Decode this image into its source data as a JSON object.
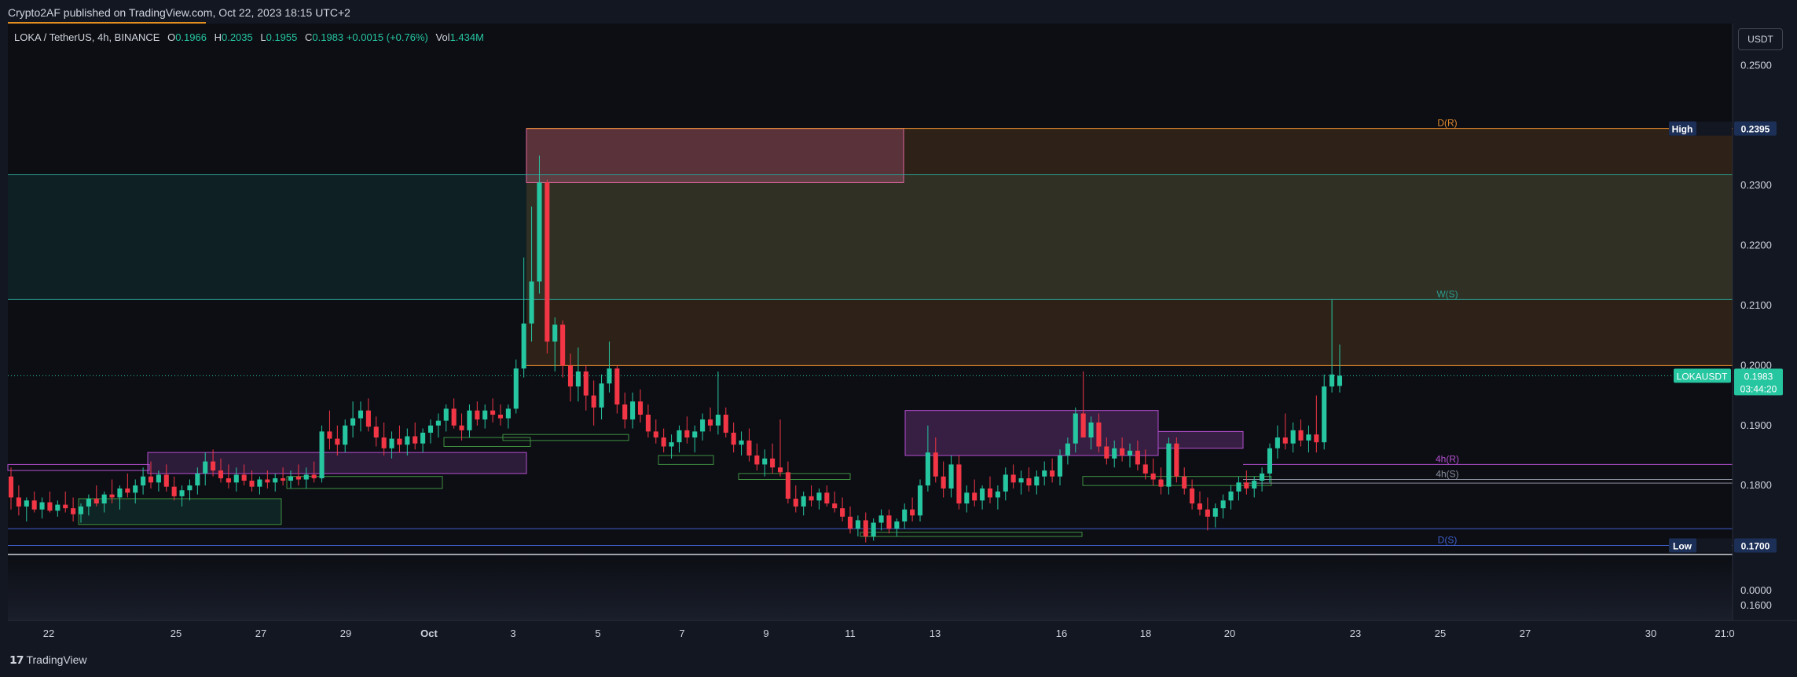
{
  "publisher": "Crypto2AF published on TradingView.com, Oct 22, 2023 18:15 UTC+2",
  "legend": {
    "symbol": "LOKA / TetherUS, 4h, BINANCE",
    "open_label": "O",
    "open": "0.1966",
    "high_label": "H",
    "high": "0.2035",
    "low_label": "L",
    "low": "0.1955",
    "close_label": "C",
    "close": "0.1983",
    "change": "+0.0015 (+0.76%)",
    "vol_label": "Vol",
    "vol": "1.434M"
  },
  "currency_button": "USDT",
  "footer_logo": "TradingView",
  "colors": {
    "background": "#0c0e14",
    "up": "#26c6a0",
    "down": "#f23645",
    "daily": "#e0892d",
    "weekly": "#2a9d8f",
    "h4": "#b64fd1",
    "daily_support": "#3f5ec7"
  },
  "chart_data": {
    "type": "candlestick",
    "symbol": "LOKAUSDT",
    "timeframe": "4h",
    "ylim": [
      0.1575,
      0.257
    ],
    "y_ticks": [
      "0.2500",
      "0.2300",
      "0.2200",
      "0.2100",
      "0.2000",
      "0.1900",
      "0.1800",
      "0.1600",
      "0.0000"
    ],
    "x_ticks": [
      "22",
      "25",
      "27",
      "29",
      "Oct",
      "3",
      "5",
      "7",
      "9",
      "11",
      "13",
      "16",
      "18",
      "20",
      "23",
      "25",
      "27",
      "30",
      "21:0"
    ],
    "levels": [
      {
        "label": "D(R)",
        "value": 0.2395
      },
      {
        "label": "W(S)",
        "value": 0.211
      },
      {
        "label": "4h(R)",
        "value": 0.1835
      },
      {
        "label": "4h(S)",
        "value": 0.181
      },
      {
        "label": "D(S)",
        "value": 0.17
      }
    ],
    "high": {
      "label": "High",
      "value": "0.2395"
    },
    "low": {
      "label": "Low",
      "value": "0.1700"
    },
    "last_price": {
      "symbol": "LOKAUSDT",
      "value": "0.1983",
      "countdown": "03:44:20"
    },
    "candles": [
      [
        0.1815,
        0.183,
        0.176,
        0.178
      ],
      [
        0.178,
        0.18,
        0.175,
        0.1765
      ],
      [
        0.1765,
        0.178,
        0.174,
        0.1775
      ],
      [
        0.1775,
        0.179,
        0.1755,
        0.176
      ],
      [
        0.176,
        0.178,
        0.1745,
        0.1772
      ],
      [
        0.1772,
        0.179,
        0.1755,
        0.1758
      ],
      [
        0.1758,
        0.1775,
        0.1748,
        0.1768
      ],
      [
        0.1768,
        0.179,
        0.1755,
        0.1762
      ],
      [
        0.1762,
        0.178,
        0.174,
        0.1752
      ],
      [
        0.1752,
        0.177,
        0.1738,
        0.1765
      ],
      [
        0.1765,
        0.1785,
        0.175,
        0.1778
      ],
      [
        0.1778,
        0.18,
        0.1765,
        0.177
      ],
      [
        0.177,
        0.179,
        0.1755,
        0.1785
      ],
      [
        0.1785,
        0.181,
        0.177,
        0.178
      ],
      [
        0.178,
        0.18,
        0.176,
        0.1795
      ],
      [
        0.1795,
        0.182,
        0.178,
        0.1788
      ],
      [
        0.1788,
        0.181,
        0.177,
        0.18
      ],
      [
        0.18,
        0.183,
        0.1785,
        0.1815
      ],
      [
        0.1815,
        0.184,
        0.1795,
        0.1805
      ],
      [
        0.1805,
        0.1825,
        0.179,
        0.1818
      ],
      [
        0.1818,
        0.1835,
        0.179,
        0.1798
      ],
      [
        0.1798,
        0.1815,
        0.1775,
        0.1782
      ],
      [
        0.1782,
        0.18,
        0.1765,
        0.1792
      ],
      [
        0.1792,
        0.181,
        0.1775,
        0.18
      ],
      [
        0.18,
        0.183,
        0.1785,
        0.182
      ],
      [
        0.182,
        0.1855,
        0.18,
        0.184
      ],
      [
        0.184,
        0.186,
        0.1815,
        0.1825
      ],
      [
        0.1825,
        0.1845,
        0.1805,
        0.1812
      ],
      [
        0.1812,
        0.1835,
        0.1795,
        0.1805
      ],
      [
        0.1805,
        0.183,
        0.179,
        0.1818
      ],
      [
        0.1818,
        0.1835,
        0.18,
        0.1808
      ],
      [
        0.1808,
        0.1825,
        0.179,
        0.1798
      ],
      [
        0.1798,
        0.1815,
        0.1785,
        0.181
      ],
      [
        0.181,
        0.1825,
        0.1795,
        0.1805
      ],
      [
        0.1805,
        0.182,
        0.179,
        0.1812
      ],
      [
        0.1812,
        0.183,
        0.18,
        0.1808
      ],
      [
        0.1808,
        0.1825,
        0.1795,
        0.1815
      ],
      [
        0.1815,
        0.1835,
        0.18,
        0.181
      ],
      [
        0.181,
        0.183,
        0.1795,
        0.1818
      ],
      [
        0.1818,
        0.184,
        0.1805,
        0.1812
      ],
      [
        0.1812,
        0.19,
        0.1805,
        0.189
      ],
      [
        0.189,
        0.1925,
        0.186,
        0.1878
      ],
      [
        0.1878,
        0.19,
        0.185,
        0.1868
      ],
      [
        0.1868,
        0.191,
        0.1855,
        0.19
      ],
      [
        0.19,
        0.194,
        0.188,
        0.1912
      ],
      [
        0.1912,
        0.194,
        0.189,
        0.1925
      ],
      [
        0.1925,
        0.1945,
        0.189,
        0.1898
      ],
      [
        0.1898,
        0.1915,
        0.1865,
        0.188
      ],
      [
        0.188,
        0.1905,
        0.185,
        0.1862
      ],
      [
        0.1862,
        0.189,
        0.1845,
        0.1878
      ],
      [
        0.1878,
        0.19,
        0.1855,
        0.1868
      ],
      [
        0.1868,
        0.1895,
        0.185,
        0.1882
      ],
      [
        0.1882,
        0.1905,
        0.186,
        0.187
      ],
      [
        0.187,
        0.1895,
        0.1855,
        0.1888
      ],
      [
        0.1888,
        0.191,
        0.187,
        0.19
      ],
      [
        0.19,
        0.192,
        0.188,
        0.1908
      ],
      [
        0.1908,
        0.1935,
        0.189,
        0.1928
      ],
      [
        0.1928,
        0.1945,
        0.1895,
        0.19
      ],
      [
        0.19,
        0.192,
        0.1875,
        0.1892
      ],
      [
        0.1892,
        0.1935,
        0.188,
        0.1925
      ],
      [
        0.1925,
        0.194,
        0.19,
        0.191
      ],
      [
        0.191,
        0.1935,
        0.1895,
        0.1925
      ],
      [
        0.1925,
        0.1945,
        0.1905,
        0.1918
      ],
      [
        0.1918,
        0.1935,
        0.19,
        0.1912
      ],
      [
        0.1912,
        0.1935,
        0.1895,
        0.1928
      ],
      [
        0.1928,
        0.201,
        0.192,
        0.1995
      ],
      [
        0.1995,
        0.218,
        0.198,
        0.207
      ],
      [
        0.207,
        0.2265,
        0.204,
        0.214
      ],
      [
        0.214,
        0.235,
        0.212,
        0.2305
      ],
      [
        0.2305,
        0.231,
        0.202,
        0.204
      ],
      [
        0.204,
        0.208,
        0.199,
        0.2068
      ],
      [
        0.2068,
        0.2075,
        0.198,
        0.2
      ],
      [
        0.2,
        0.202,
        0.194,
        0.1965
      ],
      [
        0.1965,
        0.203,
        0.194,
        0.199
      ],
      [
        0.199,
        0.2,
        0.1925,
        0.195
      ],
      [
        0.195,
        0.1975,
        0.19,
        0.193
      ],
      [
        0.193,
        0.1985,
        0.191,
        0.197
      ],
      [
        0.197,
        0.204,
        0.1955,
        0.1995
      ],
      [
        0.1995,
        0.2,
        0.192,
        0.1935
      ],
      [
        0.1935,
        0.1955,
        0.1895,
        0.191
      ],
      [
        0.191,
        0.1955,
        0.1895,
        0.194
      ],
      [
        0.194,
        0.196,
        0.1905,
        0.1918
      ],
      [
        0.1918,
        0.1935,
        0.188,
        0.189
      ],
      [
        0.189,
        0.191,
        0.187,
        0.188
      ],
      [
        0.188,
        0.1895,
        0.1855,
        0.1865
      ],
      [
        0.1865,
        0.1885,
        0.1845,
        0.1872
      ],
      [
        0.1872,
        0.19,
        0.1855,
        0.1892
      ],
      [
        0.1892,
        0.1915,
        0.187,
        0.188
      ],
      [
        0.188,
        0.19,
        0.1855,
        0.189
      ],
      [
        0.189,
        0.192,
        0.1875,
        0.191
      ],
      [
        0.191,
        0.193,
        0.189,
        0.19
      ],
      [
        0.19,
        0.199,
        0.1885,
        0.1918
      ],
      [
        0.1918,
        0.193,
        0.188,
        0.1888
      ],
      [
        0.1888,
        0.1905,
        0.1855,
        0.1868
      ],
      [
        0.1868,
        0.189,
        0.185,
        0.1875
      ],
      [
        0.1875,
        0.1895,
        0.184,
        0.185
      ],
      [
        0.185,
        0.187,
        0.1825,
        0.1835
      ],
      [
        0.1835,
        0.186,
        0.1815,
        0.1845
      ],
      [
        0.1845,
        0.187,
        0.182,
        0.183
      ],
      [
        0.183,
        0.191,
        0.1815,
        0.1822
      ],
      [
        0.1822,
        0.184,
        0.177,
        0.1778
      ],
      [
        0.1778,
        0.18,
        0.1755,
        0.1765
      ],
      [
        0.1765,
        0.179,
        0.175,
        0.1782
      ],
      [
        0.1782,
        0.18,
        0.1765,
        0.1775
      ],
      [
        0.1775,
        0.1795,
        0.176,
        0.1788
      ],
      [
        0.1788,
        0.18,
        0.1765,
        0.177
      ],
      [
        0.177,
        0.179,
        0.1755,
        0.1762
      ],
      [
        0.1762,
        0.178,
        0.174,
        0.1748
      ],
      [
        0.1748,
        0.1765,
        0.172,
        0.1728
      ],
      [
        0.1728,
        0.175,
        0.1715,
        0.1742
      ],
      [
        0.1742,
        0.1755,
        0.1705,
        0.1715
      ],
      [
        0.1715,
        0.1745,
        0.1708,
        0.1738
      ],
      [
        0.1738,
        0.176,
        0.1725,
        0.175
      ],
      [
        0.175,
        0.176,
        0.172,
        0.1728
      ],
      [
        0.1728,
        0.1745,
        0.1715,
        0.174
      ],
      [
        0.174,
        0.177,
        0.1728,
        0.176
      ],
      [
        0.176,
        0.178,
        0.174,
        0.175
      ],
      [
        0.175,
        0.181,
        0.174,
        0.18
      ],
      [
        0.18,
        0.19,
        0.179,
        0.1855
      ],
      [
        0.1855,
        0.188,
        0.1805,
        0.1815
      ],
      [
        0.1815,
        0.184,
        0.178,
        0.1795
      ],
      [
        0.1795,
        0.185,
        0.178,
        0.1835
      ],
      [
        0.1835,
        0.185,
        0.176,
        0.177
      ],
      [
        0.177,
        0.18,
        0.1755,
        0.1788
      ],
      [
        0.1788,
        0.181,
        0.1765,
        0.1775
      ],
      [
        0.1775,
        0.18,
        0.176,
        0.1795
      ],
      [
        0.1795,
        0.1815,
        0.177,
        0.178
      ],
      [
        0.178,
        0.18,
        0.176,
        0.179
      ],
      [
        0.179,
        0.183,
        0.1775,
        0.1818
      ],
      [
        0.1818,
        0.1835,
        0.1795,
        0.1805
      ],
      [
        0.1805,
        0.1825,
        0.1785,
        0.1812
      ],
      [
        0.1812,
        0.183,
        0.179,
        0.18
      ],
      [
        0.18,
        0.1825,
        0.1785,
        0.1815
      ],
      [
        0.1815,
        0.184,
        0.18,
        0.1825
      ],
      [
        0.1825,
        0.1845,
        0.1805,
        0.1815
      ],
      [
        0.1815,
        0.186,
        0.18,
        0.185
      ],
      [
        0.185,
        0.188,
        0.1835,
        0.187
      ],
      [
        0.187,
        0.193,
        0.1855,
        0.192
      ],
      [
        0.192,
        0.199,
        0.189,
        0.188
      ],
      [
        0.188,
        0.1915,
        0.186,
        0.1905
      ],
      [
        0.1905,
        0.192,
        0.1855,
        0.1865
      ],
      [
        0.1865,
        0.188,
        0.1835,
        0.1845
      ],
      [
        0.1845,
        0.1875,
        0.183,
        0.1862
      ],
      [
        0.1862,
        0.188,
        0.184,
        0.185
      ],
      [
        0.185,
        0.187,
        0.183,
        0.1858
      ],
      [
        0.1858,
        0.1875,
        0.1825,
        0.1835
      ],
      [
        0.1835,
        0.186,
        0.181,
        0.182
      ],
      [
        0.182,
        0.1845,
        0.18,
        0.181
      ],
      [
        0.181,
        0.183,
        0.1785,
        0.1798
      ],
      [
        0.1798,
        0.188,
        0.1785,
        0.187
      ],
      [
        0.187,
        0.188,
        0.1805,
        0.1815
      ],
      [
        0.1815,
        0.183,
        0.1785,
        0.1795
      ],
      [
        0.1795,
        0.181,
        0.176,
        0.177
      ],
      [
        0.177,
        0.179,
        0.175,
        0.176
      ],
      [
        0.176,
        0.178,
        0.1725,
        0.1748
      ],
      [
        0.1748,
        0.177,
        0.173,
        0.1762
      ],
      [
        0.1762,
        0.1785,
        0.1745,
        0.1775
      ],
      [
        0.1775,
        0.18,
        0.176,
        0.179
      ],
      [
        0.179,
        0.1815,
        0.1775,
        0.1805
      ],
      [
        0.1805,
        0.1825,
        0.1785,
        0.1795
      ],
      [
        0.1795,
        0.1815,
        0.178,
        0.1808
      ],
      [
        0.1808,
        0.183,
        0.179,
        0.182
      ],
      [
        0.182,
        0.187,
        0.1805,
        0.1862
      ],
      [
        0.1862,
        0.19,
        0.1845,
        0.188
      ],
      [
        0.188,
        0.192,
        0.186,
        0.187
      ],
      [
        0.187,
        0.1905,
        0.1855,
        0.1892
      ],
      [
        0.1892,
        0.191,
        0.1865,
        0.1875
      ],
      [
        0.1875,
        0.19,
        0.1855,
        0.1885
      ],
      [
        0.1885,
        0.195,
        0.1855,
        0.1872
      ],
      [
        0.1872,
        0.1985,
        0.186,
        0.1965
      ],
      [
        0.1965,
        0.211,
        0.1955,
        0.1985
      ],
      [
        0.1966,
        0.2035,
        0.1955,
        0.1983
      ]
    ]
  }
}
